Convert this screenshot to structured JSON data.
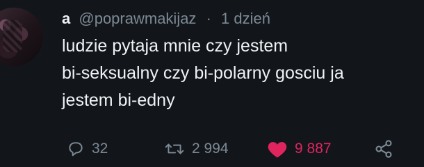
{
  "tweet": {
    "author_name": "a",
    "handle": "@poprawmakijaz",
    "separator": "·",
    "time": "1 dzień",
    "text_lines": [
      "ludzie pytaja mnie czy jestem",
      "bi-seksualny czy bi-polarny gosciu ja",
      "jestem bi-edny"
    ]
  },
  "actions": {
    "reply": {
      "icon": "reply-icon",
      "count": "32"
    },
    "retweet": {
      "icon": "retweet-icon",
      "count": "2 994"
    },
    "like": {
      "icon": "heart-icon",
      "count": "9 887",
      "color": "#e0245e"
    },
    "share": {
      "icon": "share-icon"
    }
  },
  "colors": {
    "background": "#12161b",
    "text": "#f0f3f5",
    "muted": "#7d8a94",
    "like": "#e0245e"
  }
}
